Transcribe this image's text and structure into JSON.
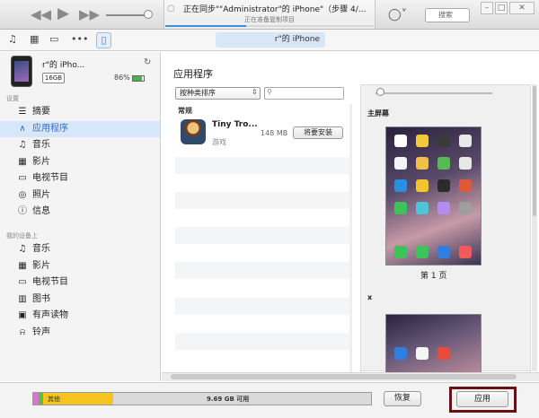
{
  "titlebar": {
    "lcd_title": "正在同步\"\"Administrator\"的 iPhone\"（步骤 4/...",
    "lcd_subtitle": "正在准备复制项目",
    "search_placeholder": "搜索",
    "account_icon": "account-icon",
    "progress_fraction": 0.39,
    "volume_fraction": 0.92
  },
  "toolbar": {
    "device_pill_label": "r\"的 iPhone"
  },
  "device": {
    "name": "r\"的 iPho...",
    "capacity": "16GB",
    "battery": "86%"
  },
  "sidebar": {
    "settings_header": "设置",
    "settings_items": [
      {
        "label": "摘要",
        "icon": "summary-icon"
      },
      {
        "label": "应用程序",
        "icon": "apps-icon",
        "selected": true
      },
      {
        "label": "音乐",
        "icon": "music-icon"
      },
      {
        "label": "影片",
        "icon": "film-icon"
      },
      {
        "label": "电视节目",
        "icon": "tv-icon"
      },
      {
        "label": "照片",
        "icon": "camera-icon"
      },
      {
        "label": "信息",
        "icon": "info-icon"
      }
    ],
    "ondevice_header": "我的设备上",
    "ondevice_items": [
      {
        "label": "音乐",
        "icon": "music-icon"
      },
      {
        "label": "影片",
        "icon": "film-icon"
      },
      {
        "label": "电视节目",
        "icon": "tv-icon"
      },
      {
        "label": "图书",
        "icon": "book-icon"
      },
      {
        "label": "有声读物",
        "icon": "audiobook-icon"
      },
      {
        "label": "铃声",
        "icon": "bell-icon"
      }
    ]
  },
  "main": {
    "title": "应用程序",
    "sort_label": "按种类排序",
    "list_header": "常规",
    "app": {
      "name": "Tiny Tro...",
      "category": "游戏",
      "size": "148 MB",
      "install_label": "将要安装"
    },
    "home_label": "主屏幕",
    "page_label": "第 1 页",
    "page2_label": "x"
  },
  "storage": {
    "other_label": "其他",
    "free_label": "9.69 GB 可用"
  },
  "buttons": {
    "restore": "恢复",
    "apply": "应用"
  },
  "colors": {
    "accent": "#2b6fc7",
    "selection": "#d7e6fa",
    "apply_highlight": "#6b1010",
    "storage_pink": "#e06fd8",
    "storage_green": "#5bbd4a",
    "storage_yellow": "#f5c421"
  }
}
